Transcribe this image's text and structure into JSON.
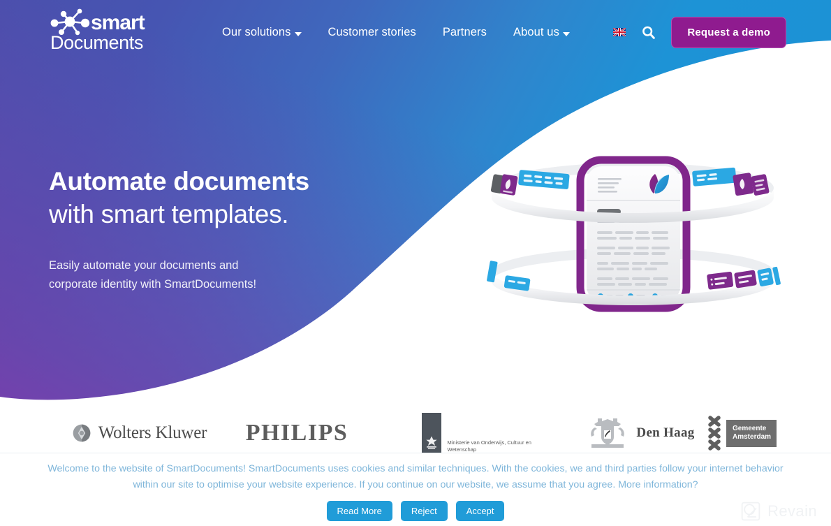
{
  "brand": {
    "logo_line1": "smart",
    "logo_line2": "Documents",
    "logo_alt": "smartdocuments-logo",
    "accent_purple": "#8f1b8f",
    "accent_blue": "#209cd8",
    "gradient_from": "#4a50ad",
    "gradient_to": "#1b90d4",
    "purple_tint": "#763faa"
  },
  "nav": {
    "items": [
      {
        "label": "Our solutions",
        "has_dropdown": true
      },
      {
        "label": "Customer stories",
        "has_dropdown": false
      },
      {
        "label": "Partners",
        "has_dropdown": false
      },
      {
        "label": "About us",
        "has_dropdown": true
      }
    ],
    "language_flag": "uk-flag-icon",
    "language_code": "EN",
    "search_icon": "search-icon",
    "cta_label": "Request a demo"
  },
  "hero": {
    "title_line1": "Automate documents",
    "title_line2": "with smart templates.",
    "subtitle_line1": "Easily automate your documents and",
    "subtitle_line2": "corporate identity with SmartDocuments!",
    "illustration_alt": "document-templates-illustration"
  },
  "clients": [
    {
      "name": "Wolters Kluwer",
      "type": "wolters-kluwer"
    },
    {
      "name": "PHILIPS",
      "type": "philips"
    },
    {
      "name": "Ministerie van Onderwijs, Cultuur en Wetenschap",
      "type": "ministerie-ocw"
    },
    {
      "name": "Den Haag",
      "type": "den-haag"
    },
    {
      "name": "Gemeente Amsterdam",
      "type": "gemeente-amsterdam"
    }
  ],
  "cookie": {
    "message": "Welcome to the website of SmartDocuments! SmartDocuments uses cookies and similar techniques. With the cookies, we and third parties follow your internet behavior within our site to optimise your website experience. If you continue on our website, we assume that you agree. More information?",
    "buttons": [
      {
        "label": "Read More"
      },
      {
        "label": "Reject"
      },
      {
        "label": "Accept"
      }
    ]
  },
  "watermark": {
    "label": "Revain"
  }
}
